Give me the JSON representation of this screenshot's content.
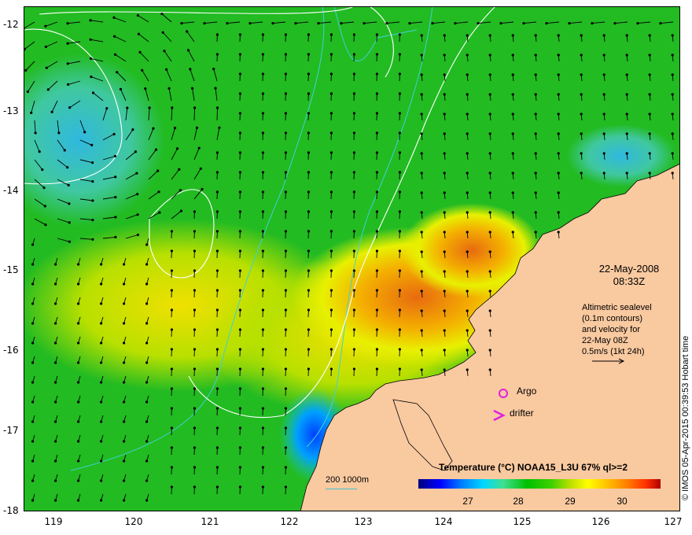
{
  "date": "22-May-2008",
  "time": "08:33Z",
  "legend_lines": [
    "Altimetric sealevel",
    "(0.1m contours)",
    "and velocity for",
    "22-May 08Z",
    "0.5m/s (1kt 24h)"
  ],
  "markers": {
    "argo": "Argo",
    "drifter": "drifter"
  },
  "colorbar": {
    "title": "Temperature (°C) NOAA15_L3U 67% ql>=2",
    "ticks": [
      "27",
      "28",
      "29",
      "30"
    ]
  },
  "scale_label": "200  1000m",
  "side_text": "© IMOS 05-Apr-2015 00:39:53 Hobart time",
  "lat_labels": [
    "-12",
    "-13",
    "-14",
    "-15",
    "-16",
    "-17",
    "-18"
  ],
  "lon_labels": [
    "119",
    "120",
    "121",
    "122",
    "123",
    "124",
    "125",
    "126",
    "127"
  ],
  "colors": {
    "land": "#f9c9a0",
    "contour": "#ffffff",
    "isobath": "#40d0d8",
    "sea": "#22bb22",
    "marker": "#e020e0"
  }
}
